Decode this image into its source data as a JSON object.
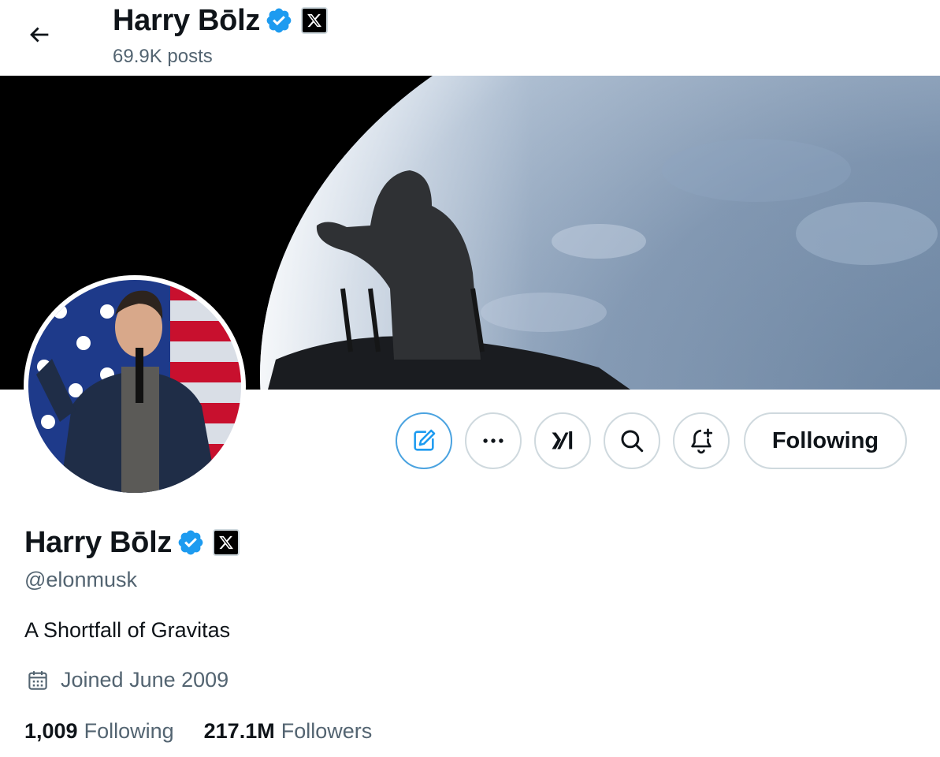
{
  "header": {
    "name": "Harry Bōlz",
    "posts": "69.9K posts"
  },
  "profile": {
    "name": "Harry Bōlz",
    "handle": "@elonmusk",
    "bio": "A Shortfall of Gravitas",
    "joined": "Joined June 2009",
    "following_count": "1,009",
    "following_label": "Following",
    "followers_count": "217.1M",
    "followers_label": "Followers"
  },
  "actions": {
    "follow_state": "Following"
  },
  "icons": [
    "back-arrow-icon",
    "verified-badge-icon",
    "x-logo-icon",
    "edit-icon",
    "more-icon",
    "grok-icon",
    "search-icon",
    "notification-bell-icon",
    "calendar-icon"
  ],
  "colors": {
    "verified": "#1d9bf0",
    "edit_ring": "#4ba3e0",
    "muted_text": "#536471",
    "border": "#cfd9de"
  }
}
